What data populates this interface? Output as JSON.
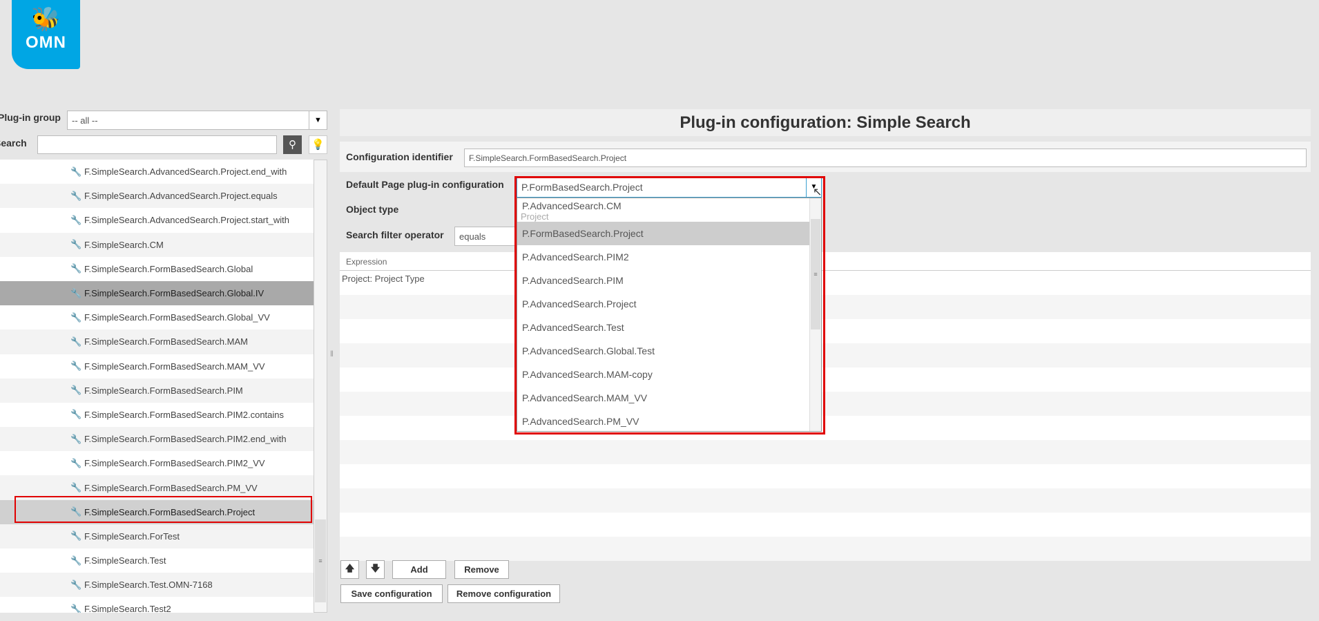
{
  "logo": {
    "text": "OMN",
    "icon": "bee-icon",
    "color": "#00a6e4"
  },
  "left": {
    "group_label": "Plug-in group",
    "group_value": "-- all --",
    "search_label": "Search",
    "search_value": "",
    "items": [
      "F.SimpleSearch.AdvancedSearch.Project.end_with",
      "F.SimpleSearch.AdvancedSearch.Project.equals",
      "F.SimpleSearch.AdvancedSearch.Project.start_with",
      "F.SimpleSearch.CM",
      "F.SimpleSearch.FormBasedSearch.Global",
      "F.SimpleSearch.FormBasedSearch.Global.IV",
      "F.SimpleSearch.FormBasedSearch.Global_VV",
      "F.SimpleSearch.FormBasedSearch.MAM",
      "F.SimpleSearch.FormBasedSearch.MAM_VV",
      "F.SimpleSearch.FormBasedSearch.PIM",
      "F.SimpleSearch.FormBasedSearch.PIM2.contains",
      "F.SimpleSearch.FormBasedSearch.PIM2.end_with",
      "F.SimpleSearch.FormBasedSearch.PIM2_VV",
      "F.SimpleSearch.FormBasedSearch.PM_VV",
      "F.SimpleSearch.FormBasedSearch.Project",
      "F.SimpleSearch.ForTest",
      "F.SimpleSearch.Test",
      "F.SimpleSearch.Test.OMN-7168",
      "F.SimpleSearch.Test2"
    ],
    "hover_index": 5,
    "selected_index": 14
  },
  "main": {
    "title": "Plug-in configuration: Simple Search",
    "config_id_label": "Configuration identifier",
    "config_id_value": "F.SimpleSearch.FormBasedSearch.Project",
    "default_page_label": "Default Page plug-in configuration",
    "default_page_value": "P.FormBasedSearch.Project",
    "object_type_label": "Object type",
    "object_type_value": "Project",
    "operator_label": "Search filter operator",
    "operator_value": "equals",
    "expr_header": "Expression",
    "expr_rows": [
      "Project: Project Type"
    ],
    "add": "Add",
    "remove": "Remove",
    "save": "Save configuration",
    "remove_config": "Remove configuration",
    "dropdown_options": [
      "P.AdvancedSearch.CM",
      "P.FormBasedSearch.Project",
      "P.AdvancedSearch.PIM2",
      "P.AdvancedSearch.PIM",
      "P.AdvancedSearch.Project",
      "P.AdvancedSearch.Test",
      "P.AdvancedSearch.Global.Test",
      "P.AdvancedSearch.MAM-copy",
      "P.AdvancedSearch.MAM_VV",
      "P.AdvancedSearch.PM_VV"
    ],
    "dropdown_selected_index": 1
  },
  "highlight_color": "#e00000"
}
